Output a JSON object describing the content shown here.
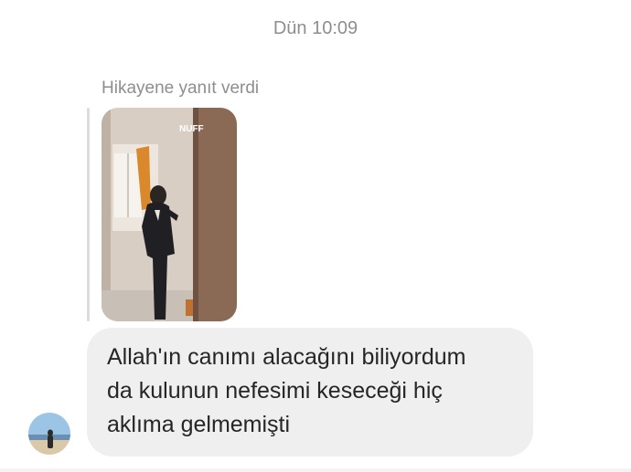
{
  "conversation": {
    "timestamp": "Dün 10:09",
    "story_reply_label": "Hikayene yanıt verdi",
    "story": {
      "watermark": "NUFF"
    },
    "message": {
      "text": "Allah'ın canımı alacağını biliyordum\nda kulunun nefesimi keseceği hiç\naklıma gelmemişti"
    }
  },
  "colors": {
    "meta_text": "#8e8e8e",
    "bubble_bg": "#efefef",
    "message_text": "#262626"
  }
}
